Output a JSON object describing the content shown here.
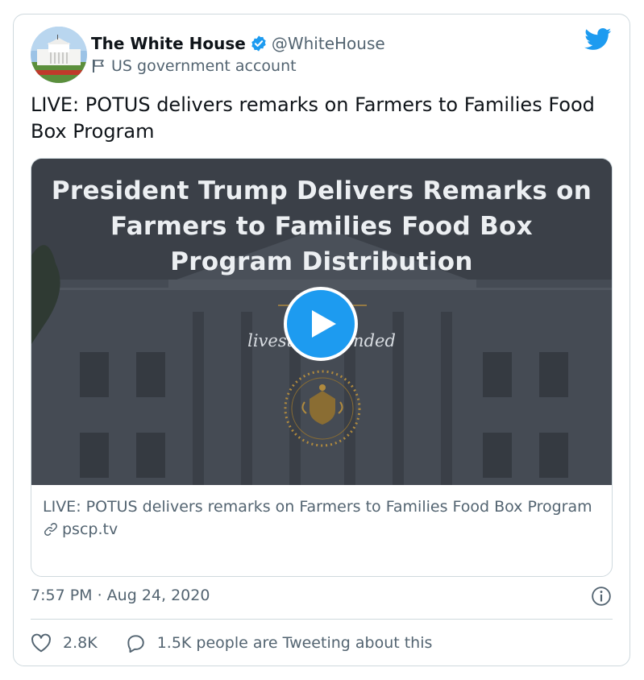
{
  "author": {
    "name": "The White House",
    "handle": "@WhiteHouse",
    "label": "US government account"
  },
  "tweet": {
    "text": "LIVE: POTUS delivers remarks on Farmers to Families Food Box Program",
    "timestamp": "7:57 PM · Aug 24, 2020"
  },
  "card": {
    "media_title": "President Trump Delivers Remarks on Farmers to Families Food Box Program Distribution",
    "media_status": "livestream ended",
    "title": "LIVE: POTUS delivers remarks on Farmers to Families Food Box Program",
    "domain": "pscp.tv"
  },
  "stats": {
    "likes": "2.8K",
    "conversation": "1.5K people are Tweeting about this"
  },
  "colors": {
    "accent": "#1d9bf0",
    "text_secondary": "#536471",
    "border": "#cfd9de"
  },
  "icons": {
    "verified": "verified-badge-icon",
    "label": "flag-icon",
    "brand": "twitter-bird-icon",
    "play": "play-icon",
    "link": "link-icon",
    "info": "info-icon",
    "like": "heart-icon",
    "reply": "speech-bubble-icon"
  }
}
